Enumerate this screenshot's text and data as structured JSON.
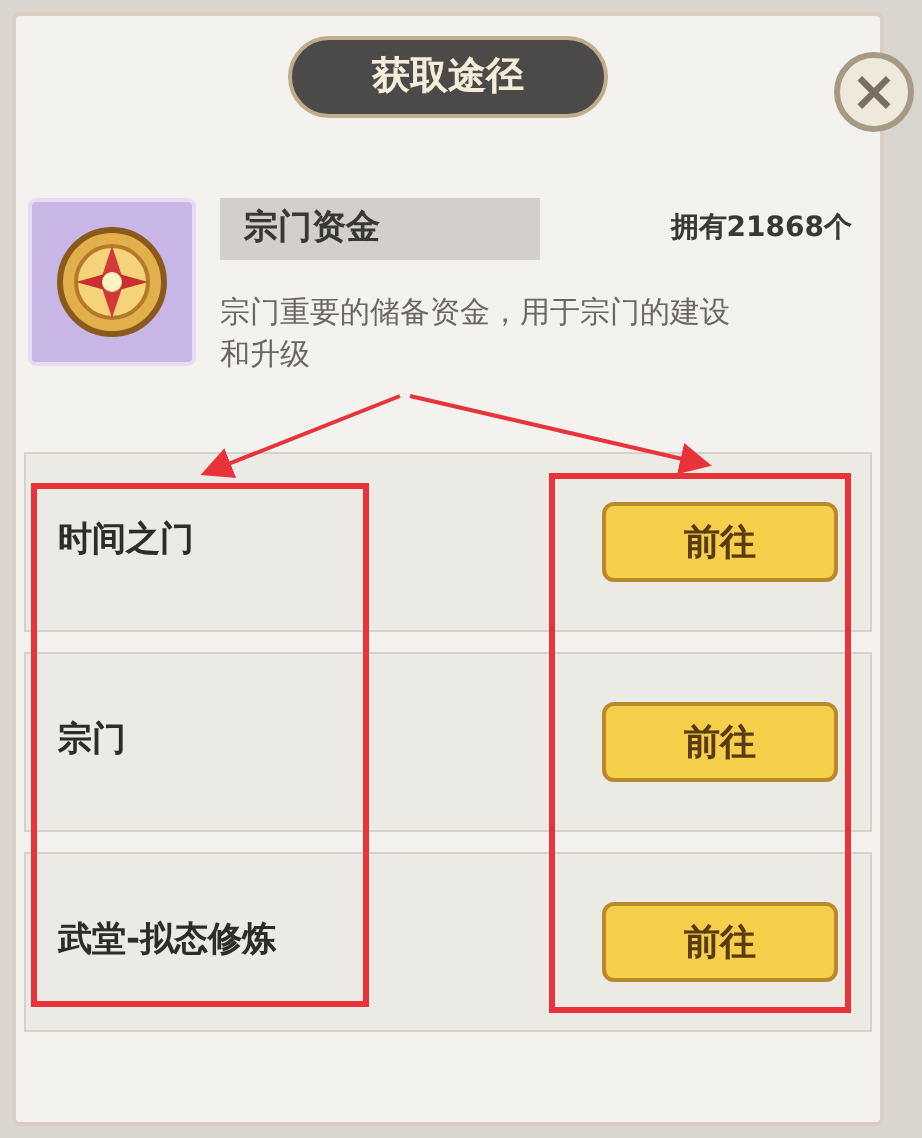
{
  "title": "获取途径",
  "close_label": "×",
  "item": {
    "name": "宗门资金",
    "owned": "拥有21868个",
    "description": "宗门重要的储备资金，用于宗门的建设和升级"
  },
  "sources": [
    {
      "label": "时间之门",
      "button": "前往"
    },
    {
      "label": "宗门",
      "button": "前往"
    },
    {
      "label": "武堂-拟态修炼",
      "button": "前往"
    }
  ]
}
